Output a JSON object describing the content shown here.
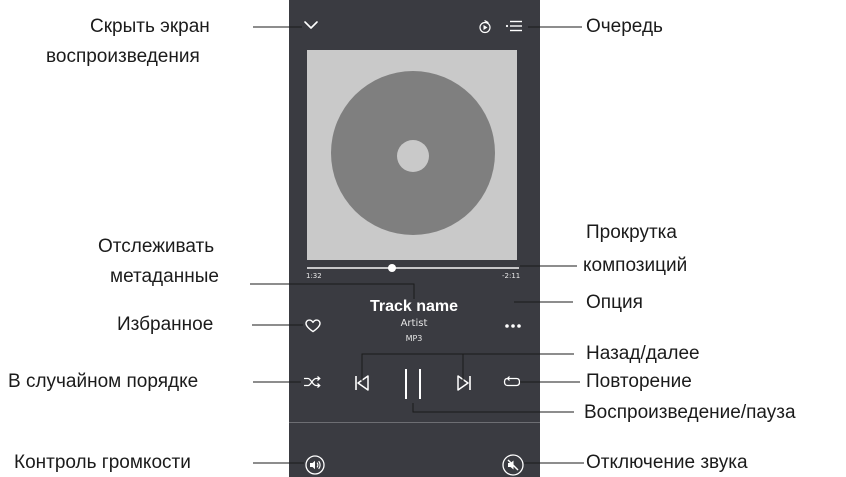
{
  "player": {
    "track_title": "Track name",
    "artist": "Artist",
    "format": "MP3",
    "time_elapsed": "1:32",
    "time_remaining": "-2:11",
    "progress_fraction": 0.4
  },
  "labels": {
    "hide_player_line1": "Скрыть экран",
    "hide_player_line2": "воспроизведения",
    "queue": "Очередь",
    "scroll_line1": "Прокрутка",
    "scroll_line2": "композиций",
    "track_meta_line1": "Отслеживать",
    "track_meta_line2": "метаданные",
    "options": "Опция",
    "favorite": "Избранное",
    "prev_next": "Назад/далее",
    "shuffle": "В случайном порядке",
    "repeat": "Повторение",
    "play_pause": "Воспроизведение/пауза",
    "volume": "Контроль громкости",
    "mute": "Отключение звука"
  },
  "icons": {
    "collapse": "chevron-down-icon",
    "airplay": "airplay-icon",
    "queue": "queue-list-icon",
    "favorite": "heart-icon",
    "more": "more-dots-icon",
    "shuffle": "shuffle-icon",
    "previous": "skip-previous-icon",
    "play_pause": "pause-icon",
    "next": "skip-next-icon",
    "repeat": "repeat-icon",
    "volume": "volume-icon",
    "mute": "mute-icon"
  },
  "colors": {
    "player_background": "#3a3b41",
    "artwork_background": "#c9c9c9",
    "disc": "#7f7f7f",
    "icon": "#ffffff",
    "annotation_text": "#1b1b1b"
  }
}
